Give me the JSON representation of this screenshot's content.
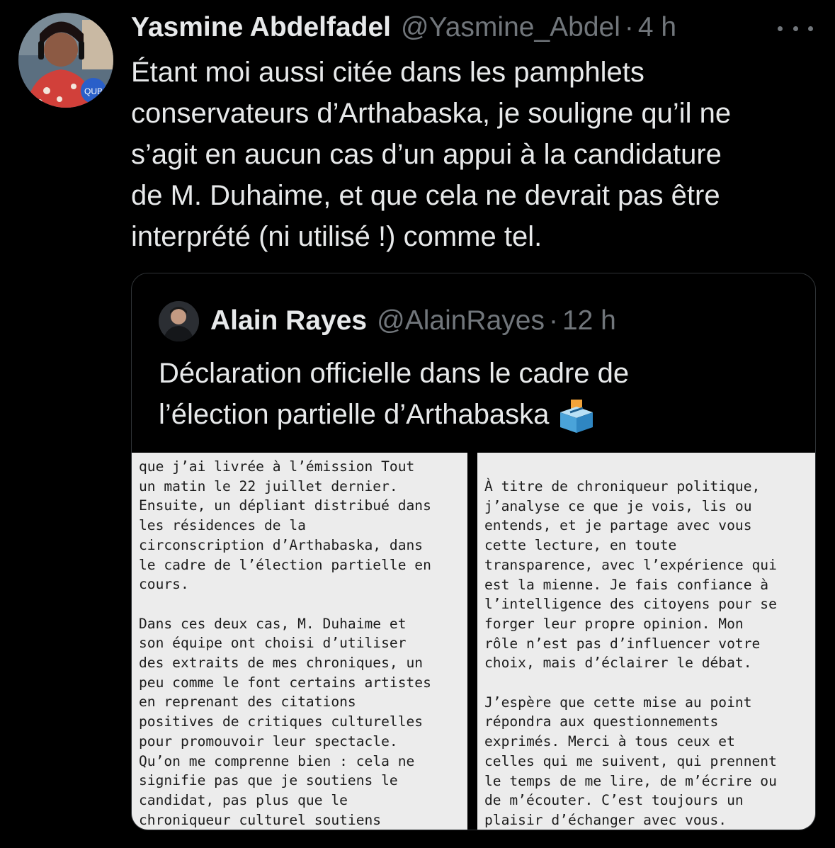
{
  "tweet": {
    "author_name": "Yasmine Abdelfadel",
    "handle": "@Yasmine_Abdel",
    "separator": "·",
    "time": "4 h",
    "text_lines": [
      "Étant moi aussi citée dans les pamphlets",
      "conservateurs d’Arthabaska, je souligne qu’il ne",
      "s’agit en aucun cas d’un appui à la candidature",
      "de M. Duhaime, et que cela ne devrait pas être",
      "interprété (ni utilisé !) comme tel."
    ],
    "avatar_mic_label": "QUB"
  },
  "quote": {
    "author_name": "Alain Rayes",
    "handle": "@AlainRayes",
    "separator": "·",
    "time": "12 h",
    "text_lines": [
      "Déclaration officielle dans le cadre de",
      "l’élection partielle d’Arthabaska"
    ],
    "emoji_icon": "ballot-box-icon",
    "document": {
      "left_lines": [
        "que j’ai livrée à l’émission Tout",
        "un matin le 22 juillet dernier.",
        "Ensuite, un dépliant distribué dans",
        "les résidences de la",
        "circonscription d’Arthabaska, dans",
        "le cadre de l’élection partielle en",
        "cours.",
        "",
        "Dans ces deux cas, M. Duhaime et",
        "son équipe ont choisi d’utiliser",
        "des extraits de mes chroniques, un",
        "peu comme le font certains artistes",
        "en reprenant des citations",
        "positives de critiques culturelles",
        "pour promouvoir leur spectacle.",
        "Qu’on me comprenne bien : cela ne",
        "signifie pas que je soutiens le",
        "candidat, pas plus que le",
        "chroniqueur culturel soutiens"
      ],
      "right_lines": [
        "À titre de chroniqueur politique,",
        "j’analyse ce que je vois, lis ou",
        "entends, et je partage avec vous",
        "cette lecture, en toute",
        "transparence, avec l’expérience qui",
        "est la mienne. Je fais confiance à",
        "l’intelligence des citoyens pour se",
        "forger leur propre opinion. Mon",
        "rôle n’est pas d’influencer votre",
        "choix, mais d’éclairer le débat.",
        "",
        "J’espère que cette mise au point",
        "répondra aux questionnements",
        "exprimés. Merci à tous ceux et",
        "celles qui me suivent, qui prennent",
        "le temps de me lire, de m’écrire ou",
        "de m’écouter. C’est toujours un",
        "plaisir d’échanger avec vous."
      ]
    }
  },
  "icons": {
    "more": "more-horizontal-icon"
  },
  "colors": {
    "background": "#000000",
    "text_primary": "#e7e9ea",
    "text_secondary": "#71767b",
    "border": "#2f3336",
    "document_bg": "#ececec"
  }
}
